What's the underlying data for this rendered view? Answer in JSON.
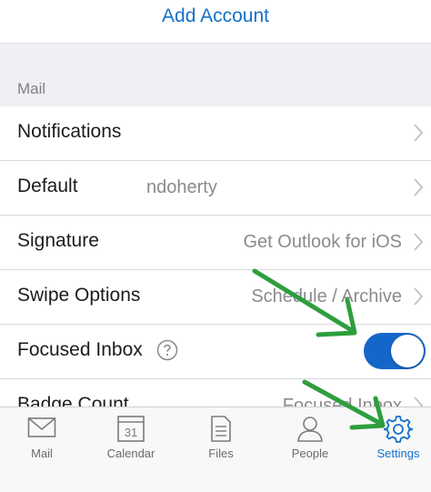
{
  "header": {
    "add_account_label": "Add Account"
  },
  "section": {
    "label": "Mail"
  },
  "rows": [
    {
      "label": "Notifications",
      "value": ""
    },
    {
      "label": "Default",
      "value": "ndoherty"
    },
    {
      "label": "Signature",
      "value": "Get Outlook for iOS"
    },
    {
      "label": "Swipe Options",
      "value": "Schedule / Archive"
    },
    {
      "label": "Focused Inbox",
      "toggle_on": true
    },
    {
      "label": "Badge Count",
      "value": "Focused Inbox"
    }
  ],
  "tabs": [
    {
      "label": "Mail",
      "icon": "mail-icon"
    },
    {
      "label": "Calendar",
      "icon": "calendar-icon",
      "calendar_day": "31"
    },
    {
      "label": "Files",
      "icon": "file-icon"
    },
    {
      "label": "People",
      "icon": "person-icon"
    },
    {
      "label": "Settings",
      "icon": "gear-icon",
      "active": true
    }
  ],
  "colors": {
    "accent": "#1570c9",
    "toggle_on": "#1566c9",
    "annotation_arrow": "#2e9e3e"
  }
}
